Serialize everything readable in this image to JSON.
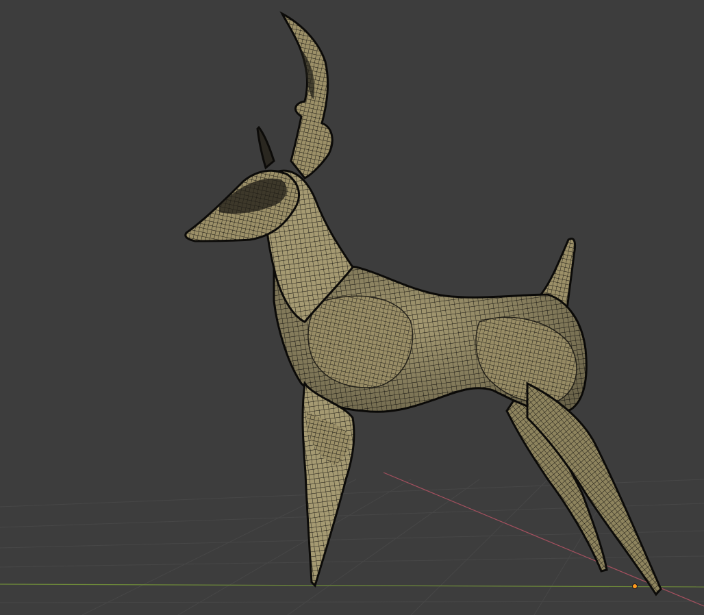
{
  "viewport": {
    "background_color": "#3d3d3d",
    "grid_color": "#484848",
    "x_axis_color": "#a5505f",
    "y_axis_color": "#6e8a3a",
    "origin_color": "#ff9a1e",
    "mesh_fill_color": "#a59a72",
    "mesh_wire_color": "#161410",
    "mesh_outline_color": "#0c0b09",
    "object_name": "deer-mesh",
    "view_mode": "wireframe-overlay"
  }
}
